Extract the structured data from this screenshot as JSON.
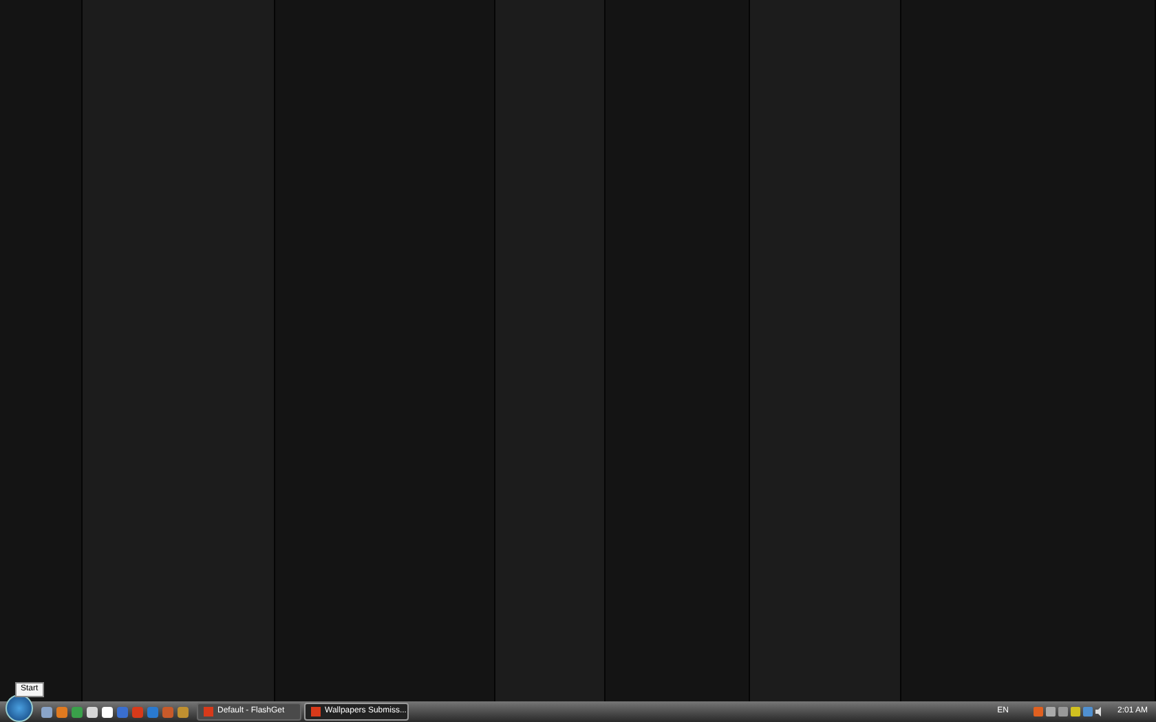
{
  "tooltip": {
    "text": "Start"
  },
  "taskbar": {
    "windows": [
      {
        "label": "Default - FlashGet",
        "selected": false
      },
      {
        "label": "Wallpapers Submiss...",
        "selected": true
      }
    ],
    "language": "EN",
    "clock": "2:01 AM"
  }
}
